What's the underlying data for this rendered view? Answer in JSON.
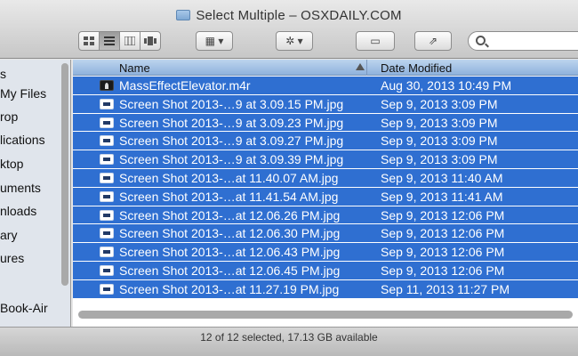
{
  "window": {
    "title": "Select Multiple – OSXDAILY.COM"
  },
  "toolbar": {
    "view_icons": [
      "icon-view-icon",
      "list-view-icon",
      "column-view-icon",
      "coverflow-view-icon"
    ],
    "arrange_icon": "arrange-icon",
    "action_icon": "gear-icon",
    "share_icon": "share-icon",
    "search_placeholder": ""
  },
  "sidebar": {
    "items": [
      {
        "label": "s"
      },
      {
        "label": "My Files"
      },
      {
        "label": "rop"
      },
      {
        "label": "lications"
      },
      {
        "label": "ktop"
      },
      {
        "label": "uments"
      },
      {
        "label": "nloads"
      },
      {
        "label": "ary"
      },
      {
        "label": "ures"
      },
      {
        "label": "Book-Air"
      }
    ]
  },
  "columns": {
    "name": "Name",
    "date": "Date Modified"
  },
  "files": [
    {
      "name": "MassEffectElevator.m4r",
      "date": "Aug 30, 2013 10:49 PM",
      "type": "audio"
    },
    {
      "name": "Screen Shot 2013-…9 at 3.09.15 PM.jpg",
      "date": "Sep 9, 2013 3:09 PM",
      "type": "image"
    },
    {
      "name": "Screen Shot 2013-…9 at 3.09.23 PM.jpg",
      "date": "Sep 9, 2013 3:09 PM",
      "type": "image"
    },
    {
      "name": "Screen Shot 2013-…9 at 3.09.27 PM.jpg",
      "date": "Sep 9, 2013 3:09 PM",
      "type": "image"
    },
    {
      "name": "Screen Shot 2013-…9 at 3.09.39 PM.jpg",
      "date": "Sep 9, 2013 3:09 PM",
      "type": "image"
    },
    {
      "name": "Screen Shot 2013-…at 11.40.07 AM.jpg",
      "date": "Sep 9, 2013 11:40 AM",
      "type": "image"
    },
    {
      "name": "Screen Shot 2013-…at 11.41.54 AM.jpg",
      "date": "Sep 9, 2013 11:41 AM",
      "type": "image"
    },
    {
      "name": "Screen Shot 2013-…at 12.06.26 PM.jpg",
      "date": "Sep 9, 2013 12:06 PM",
      "type": "image"
    },
    {
      "name": "Screen Shot 2013-…at 12.06.30 PM.jpg",
      "date": "Sep 9, 2013 12:06 PM",
      "type": "image"
    },
    {
      "name": "Screen Shot 2013-…at 12.06.43 PM.jpg",
      "date": "Sep 9, 2013 12:06 PM",
      "type": "image"
    },
    {
      "name": "Screen Shot 2013-…at 12.06.45 PM.jpg",
      "date": "Sep 9, 2013 12:06 PM",
      "type": "image"
    },
    {
      "name": "Screen Shot 2013-…at 11.27.19 PM.jpg",
      "date": "Sep 11, 2013 11:27 PM",
      "type": "image"
    }
  ],
  "status": {
    "text": "12 of 12 selected, 17.13 GB available"
  },
  "colors": {
    "selection": "#2f6fd1",
    "header": "#9fbfe4"
  }
}
